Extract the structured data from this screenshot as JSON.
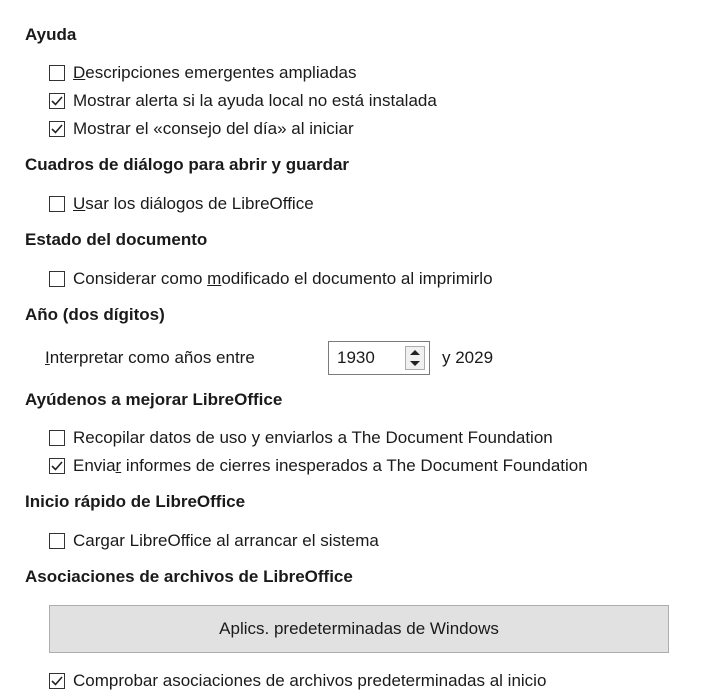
{
  "sections": {
    "help": {
      "title": "Ayuda",
      "options": [
        {
          "pre": "",
          "u": "D",
          "post": "escripciones emergentes ampliadas",
          "checked": false
        },
        {
          "pre": "Mostrar alerta si la ayuda local no está instalada",
          "u": "",
          "post": "",
          "checked": true
        },
        {
          "pre": "Mostrar el «consejo del día» al iniciar",
          "u": "",
          "post": "",
          "checked": true
        }
      ]
    },
    "dialogs": {
      "title": "Cuadros de diálogo para abrir y guardar",
      "options": [
        {
          "pre": "",
          "u": "U",
          "post": "sar los diálogos de LibreOffice",
          "checked": false
        }
      ]
    },
    "doc_status": {
      "title": "Estado del documento",
      "options": [
        {
          "pre": "Considerar como ",
          "u": "m",
          "post": "odificado el documento al imprimirlo",
          "checked": false
        }
      ]
    },
    "year": {
      "title": "Año (dos dígitos)",
      "label_u": "I",
      "label_post": "nterpretar como años entre",
      "value": "1930",
      "suffix": "y 2029"
    },
    "improve": {
      "title": "Ayúdenos a mejorar LibreOffice",
      "options": [
        {
          "pre": "Recopilar datos de uso y enviarlos a The Document Foundation",
          "u": "",
          "post": "",
          "checked": false
        },
        {
          "pre": "Envia",
          "u": "r",
          "post": " informes de cierres inesperados a The Document Foundation",
          "checked": true
        }
      ]
    },
    "quickstart": {
      "title": "Inicio rápido de LibreOffice",
      "options": [
        {
          "pre": "Cargar LibreOffice al arrancar el sistema",
          "u": "",
          "post": "",
          "checked": false
        }
      ]
    },
    "assoc": {
      "title": "Asociaciones de archivos de LibreOffice",
      "button_label": "Aplics. predeterminadas de Windows",
      "options": [
        {
          "pre": "Comprobar asociaciones de archivos predeterminadas al inicio",
          "u": "",
          "post": "",
          "checked": true
        }
      ]
    }
  }
}
